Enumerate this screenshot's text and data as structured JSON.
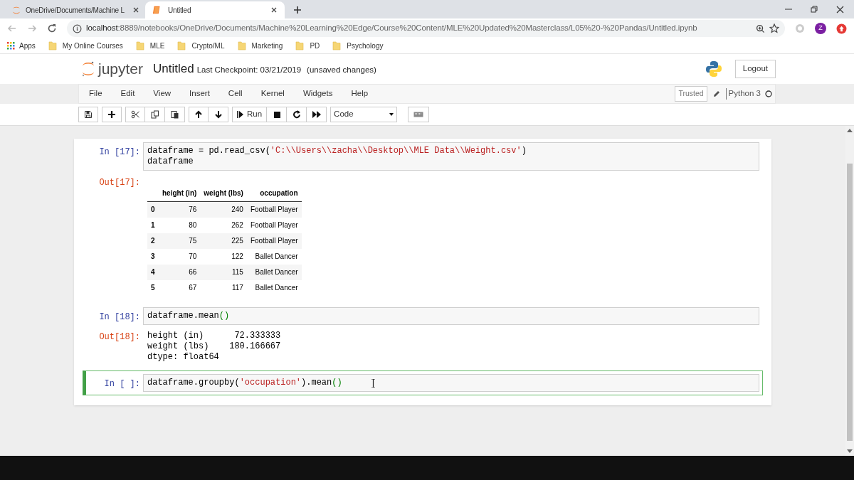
{
  "browser": {
    "tabs": [
      {
        "title": "OneDrive/Documents/Machine L",
        "selected": false
      },
      {
        "title": "Untitled",
        "selected": true
      }
    ],
    "url_host": "localhost",
    "url_rest": ":8889/notebooks/OneDrive/Documents/Machine%20Learning%20Edge/Course%20Content/MLE%20Updated%20Masterclass/L05%20-%20Pandas/Untitled.ipynb",
    "avatar": "Z",
    "apps": "Apps",
    "bookmarks": [
      "My Online Courses",
      "MLE",
      "Crypto/ML",
      "Marketing",
      "PD",
      "Psychology"
    ]
  },
  "header": {
    "logo": "jupyter",
    "title": "Untitled",
    "checkpoint": "Last Checkpoint: 03/21/2019",
    "unsaved": "(unsaved changes)",
    "logout": "Logout"
  },
  "menu": [
    "File",
    "Edit",
    "View",
    "Insert",
    "Cell",
    "Kernel",
    "Widgets",
    "Help"
  ],
  "status": {
    "trusted": "Trusted",
    "kernel": "Python 3"
  },
  "toolbar": {
    "run": "Run",
    "cell_type": "Code"
  },
  "cells": [
    {
      "prompt": "In [17]:",
      "selected": false,
      "code": [
        [
          {
            "t": "dataframe = pd.read_csv(",
            "kind": "plain"
          },
          {
            "t": "'C:\\\\Users\\\\zacha\\\\Desktop\\\\MLE Data\\\\Weight.csv'",
            "kind": "string"
          },
          {
            "t": ")",
            "kind": "plain"
          }
        ],
        [
          {
            "t": "dataframe",
            "kind": "plain"
          }
        ]
      ],
      "output": {
        "prompt": "Out[17]:",
        "kind": "table",
        "columns": [
          "height (in)",
          "weight (lbs)",
          "occupation"
        ],
        "rows": [
          {
            "index": "0",
            "cells": [
              "76",
              "240",
              "Football Player"
            ]
          },
          {
            "index": "1",
            "cells": [
              "80",
              "262",
              "Football Player"
            ]
          },
          {
            "index": "2",
            "cells": [
              "75",
              "225",
              "Football Player"
            ]
          },
          {
            "index": "3",
            "cells": [
              "70",
              "122",
              "Ballet Dancer"
            ]
          },
          {
            "index": "4",
            "cells": [
              "66",
              "115",
              "Ballet Dancer"
            ]
          },
          {
            "index": "5",
            "cells": [
              "67",
              "117",
              "Ballet Dancer"
            ]
          }
        ]
      }
    },
    {
      "prompt": "In [18]:",
      "selected": false,
      "code": [
        [
          {
            "t": "dataframe.mean",
            "kind": "plain"
          },
          {
            "t": "()",
            "kind": "bracket"
          }
        ]
      ],
      "output": {
        "prompt": "Out[18]:",
        "kind": "text",
        "lines": [
          "height (in)      72.333333",
          "weight (lbs)    180.166667",
          "dtype: float64"
        ]
      }
    },
    {
      "prompt": "In [ ]:",
      "selected": true,
      "code": [
        [
          {
            "t": "dataframe.groupby(",
            "kind": "plain"
          },
          {
            "t": "'occupation'",
            "kind": "string"
          },
          {
            "t": ").mean",
            "kind": "plain"
          },
          {
            "t": "()",
            "kind": "bracket"
          }
        ]
      ]
    }
  ]
}
